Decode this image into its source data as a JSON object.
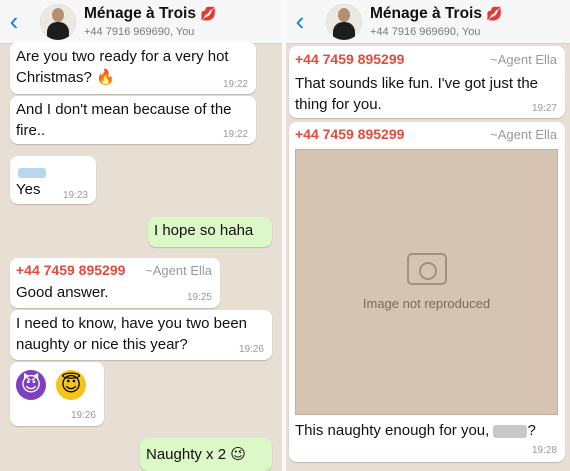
{
  "left_panel": {
    "header": {
      "back_glyph": "‹",
      "avatar_icon": "contact-avatar",
      "title": "Ménage à Trois",
      "title_icon": "💋",
      "subtitle": "+44 7916 969690, You"
    },
    "messages": [
      {
        "type": "incoming",
        "text": "Are you two ready for a very hot Christmas?",
        "emoji": "🔥",
        "time": "19:22"
      },
      {
        "type": "incoming",
        "text": "And I don't mean because of the fire..",
        "time": "19:22"
      },
      {
        "type": "incoming",
        "text": "Yes",
        "time": "19:23",
        "sender_redacted": true
      },
      {
        "type": "outgoing",
        "text": "I hope so haha"
      },
      {
        "type": "incoming",
        "sender": "+44 7459 895299",
        "agent": "~Agent Ella",
        "text": "Good answer.",
        "time": "19:25"
      },
      {
        "type": "incoming",
        "text": "I need to know, have you two been naughty or nice this year?",
        "time": "19:26"
      },
      {
        "type": "incoming",
        "emojis": [
          "😈",
          "😇"
        ],
        "time": "19:26"
      },
      {
        "type": "outgoing",
        "text": "Naughty x 2",
        "emoji": "😉"
      }
    ]
  },
  "right_panel": {
    "header": {
      "back_glyph": "‹",
      "avatar_icon": "contact-avatar",
      "title": "Ménage à Trois",
      "title_icon": "💋",
      "subtitle": "+44 7916 969690, You"
    },
    "messages": [
      {
        "type": "incoming",
        "sender": "+44 7459 895299",
        "agent": "~Agent Ella",
        "text": "That sounds like fun. I've got just the thing for you.",
        "time": "19:27"
      },
      {
        "type": "incoming_image",
        "sender": "+44 7459 895299",
        "agent": "~Agent Ella",
        "image_placeholder": "Image not reproduced",
        "caption": "This naughty enough for you,",
        "caption_end": "?",
        "time": "19:28"
      }
    ]
  },
  "colors": {
    "chat_background": "#e7dfd4",
    "incoming_bubble": "#ffffff",
    "outgoing_bubble": "#dcf8c6",
    "sender_name": "#e34b3c",
    "ios_blue": "#0a7cf5"
  }
}
